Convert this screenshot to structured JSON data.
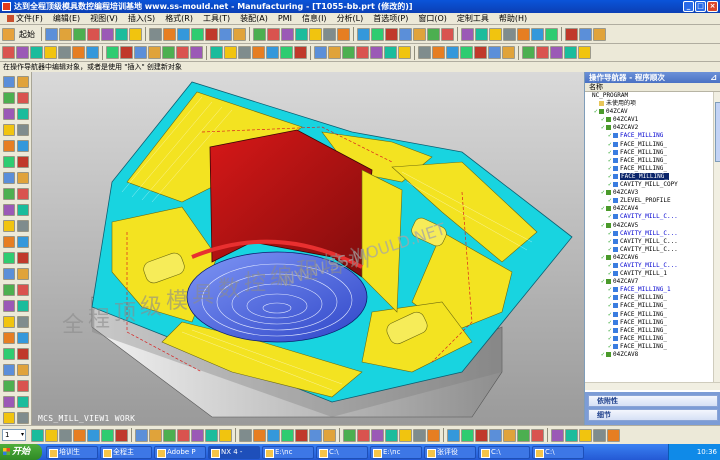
{
  "window": {
    "title": "达到全程顶级模具数控编程培训基地 www.ss-mould.net - Manufacturing - [T1055-bb.prt (修改的)]",
    "buttons": [
      "_",
      "□",
      "×"
    ]
  },
  "menu": [
    "文件(F)",
    "编辑(E)",
    "视图(V)",
    "插入(S)",
    "格式(R)",
    "工具(T)",
    "装配(A)",
    "PMI",
    "信息(I)",
    "分析(L)",
    "首选项(P)",
    "窗口(O)",
    "定制工具",
    "帮助(H)"
  ],
  "toolbar": {
    "start_label": "起始"
  },
  "hint": "在操作导航器中编辑对象，或者是使用 \"插入\" 创建新对象",
  "viewport": {
    "view_label": "MCS_MILL_VIEW1 WORK",
    "watermark_url": "WWW.SS-MOULD.NET",
    "watermark_cn": [
      "全",
      "程",
      "顶",
      "级",
      "模",
      "具",
      "数",
      "控",
      "编",
      "程",
      "培",
      "训"
    ]
  },
  "navigator": {
    "title": "操作导航器 - 程序顺次",
    "column_name": "名称",
    "rows": [
      {
        "text": "NC_PROGRAM",
        "indent": 0,
        "check": "",
        "icon": "",
        "style": ""
      },
      {
        "text": "未使用的项",
        "indent": 1,
        "check": "",
        "icon": "fld",
        "style": ""
      },
      {
        "text": "04ZCAV",
        "indent": 1,
        "check": "✓",
        "icon": "grp",
        "style": ""
      },
      {
        "text": "04ZCAV1",
        "indent": 2,
        "check": "✓",
        "icon": "grp",
        "style": ""
      },
      {
        "text": "04ZCAV2",
        "indent": 2,
        "check": "✓",
        "icon": "grp",
        "style": ""
      },
      {
        "text": "FACE_MILLING",
        "indent": 3,
        "check": "✓",
        "icon": "op",
        "style": "blue"
      },
      {
        "text": "FACE_MILLING_",
        "indent": 3,
        "check": "✓",
        "icon": "op",
        "style": ""
      },
      {
        "text": "FACE_MILLING_",
        "indent": 3,
        "check": "✓",
        "icon": "op",
        "style": ""
      },
      {
        "text": "FACE_MILLING_",
        "indent": 3,
        "check": "✓",
        "icon": "op",
        "style": ""
      },
      {
        "text": "FACE_MILLING_",
        "indent": 3,
        "check": "✓",
        "icon": "op",
        "style": ""
      },
      {
        "text": "FACE_MILLING_",
        "indent": 3,
        "check": "✓",
        "icon": "op",
        "style": "sel"
      },
      {
        "text": "CAVITY_MILL_COPY",
        "indent": 3,
        "check": "✓",
        "icon": "op",
        "style": ""
      },
      {
        "text": "04ZCAV3",
        "indent": 2,
        "check": "✓",
        "icon": "grp",
        "style": ""
      },
      {
        "text": "ZLEVEL_PROFILE",
        "indent": 3,
        "check": "✓",
        "icon": "op",
        "style": ""
      },
      {
        "text": "04ZCAV4",
        "indent": 2,
        "check": "✓",
        "icon": "grp",
        "style": ""
      },
      {
        "text": "CAVITY_MILL_C...",
        "indent": 3,
        "check": "✓",
        "icon": "op",
        "style": "blue"
      },
      {
        "text": "04ZCAV5",
        "indent": 2,
        "check": "✓",
        "icon": "grp",
        "style": ""
      },
      {
        "text": "CAVITY_MILL_C...",
        "indent": 3,
        "check": "✓",
        "icon": "op",
        "style": "blue"
      },
      {
        "text": "CAVITY_MILL_C...",
        "indent": 3,
        "check": "✓",
        "icon": "op",
        "style": ""
      },
      {
        "text": "CAVITY_MILL_C...",
        "indent": 3,
        "check": "✓",
        "icon": "op",
        "style": ""
      },
      {
        "text": "04ZCAV6",
        "indent": 2,
        "check": "✓",
        "icon": "grp",
        "style": ""
      },
      {
        "text": "CAVITY_MILL_C...",
        "indent": 3,
        "check": "✓",
        "icon": "op",
        "style": "blue"
      },
      {
        "text": "CAVITY_MILL_1",
        "indent": 3,
        "check": "✓",
        "icon": "op",
        "style": ""
      },
      {
        "text": "04ZCAV7",
        "indent": 2,
        "check": "✓",
        "icon": "grp",
        "style": ""
      },
      {
        "text": "FACE_MILLING_1",
        "indent": 3,
        "check": "✓",
        "icon": "op",
        "style": "blue"
      },
      {
        "text": "FACE_MILLING_",
        "indent": 3,
        "check": "✓",
        "icon": "op",
        "style": ""
      },
      {
        "text": "FACE_MILLING_",
        "indent": 3,
        "check": "✓",
        "icon": "op",
        "style": ""
      },
      {
        "text": "FACE_MILLING_",
        "indent": 3,
        "check": "✓",
        "icon": "op",
        "style": ""
      },
      {
        "text": "FACE_MILLING_",
        "indent": 3,
        "check": "✓",
        "icon": "op",
        "style": ""
      },
      {
        "text": "FACE_MILLING_",
        "indent": 3,
        "check": "✓",
        "icon": "op",
        "style": ""
      },
      {
        "text": "FACE_MILLING_",
        "indent": 3,
        "check": "✓",
        "icon": "op",
        "style": ""
      },
      {
        "text": "FACE_MILLING_",
        "indent": 3,
        "check": "✓",
        "icon": "op",
        "style": ""
      },
      {
        "text": "04ZCAV8",
        "indent": 2,
        "check": "✓",
        "icon": "grp",
        "style": ""
      }
    ],
    "sections": [
      "依附性",
      "细节"
    ]
  },
  "lower_toolbar": {
    "zoom_value": "1"
  },
  "taskbar": {
    "start": "开始",
    "tasks": [
      {
        "label": "培训生"
      },
      {
        "label": "全程主"
      },
      {
        "label": "Adobe P"
      },
      {
        "label": "NX 4 -"
      },
      {
        "label": "E:\\nc"
      },
      {
        "label": "C:\\"
      },
      {
        "label": "E:\\nc"
      },
      {
        "label": "张评役"
      },
      {
        "label": "C:\\"
      },
      {
        "label": "C:\\"
      }
    ],
    "clock": "10:36"
  }
}
